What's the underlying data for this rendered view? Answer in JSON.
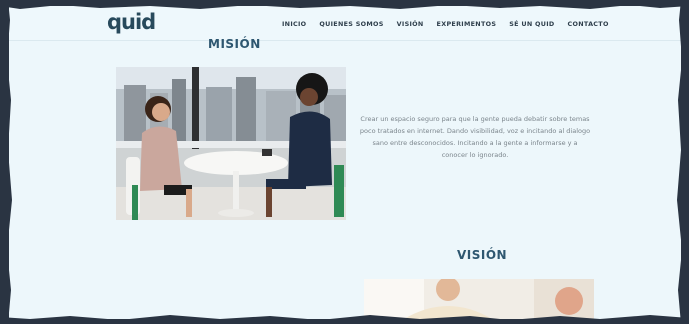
{
  "header": {
    "logo_text": "quid",
    "nav": [
      "INICIO",
      "QUIENES SOMOS",
      "VISIÓN",
      "EXPERIMENTOS",
      "SÉ UN QUID",
      "CONTACTO"
    ]
  },
  "mision": {
    "title": "MISIÓN",
    "body": "Crear un espacio seguro para que la gente pueda debatir sobre temas poco tratados en internet. Dando visibilidad, voz e incitando al dialogo sano entre desconocidos. Incitando a la gente a informarse y a conocer lo ignorado.",
    "image_alt": "two women talking at a table"
  },
  "vision": {
    "title": "VISIÓN",
    "image_alt": "smiling person"
  },
  "colors": {
    "background": "#edf7fb",
    "accent": "#2e5770",
    "frame": "#2a3442"
  }
}
